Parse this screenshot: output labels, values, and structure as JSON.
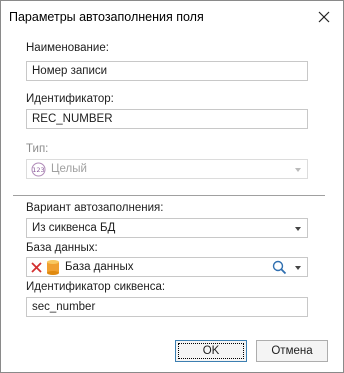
{
  "window": {
    "title": "Параметры автозаполнения поля"
  },
  "name_field": {
    "label": "Наименование:",
    "value": "Номер записи"
  },
  "id_field": {
    "label": "Идентификатор:",
    "value": "REC_NUMBER"
  },
  "type_field": {
    "label": "Тип:",
    "value": "Целый",
    "icon": "integer-type-icon",
    "disabled": true
  },
  "autofill": {
    "label": "Вариант автозаполнения:",
    "value": "Из сиквенса БД"
  },
  "database": {
    "label": "База данных:",
    "value": "База данных",
    "icons": [
      "clear-icon",
      "database-icon",
      "search-icon"
    ]
  },
  "sequence": {
    "label": "Идентификатор сиквенса:",
    "value": "sec_number"
  },
  "buttons": {
    "ok": "OK",
    "cancel": "Отмена"
  },
  "colors": {
    "accent": "#3c7fb1",
    "clear_red": "#d32f2f",
    "db_orange": "#f0a030"
  }
}
